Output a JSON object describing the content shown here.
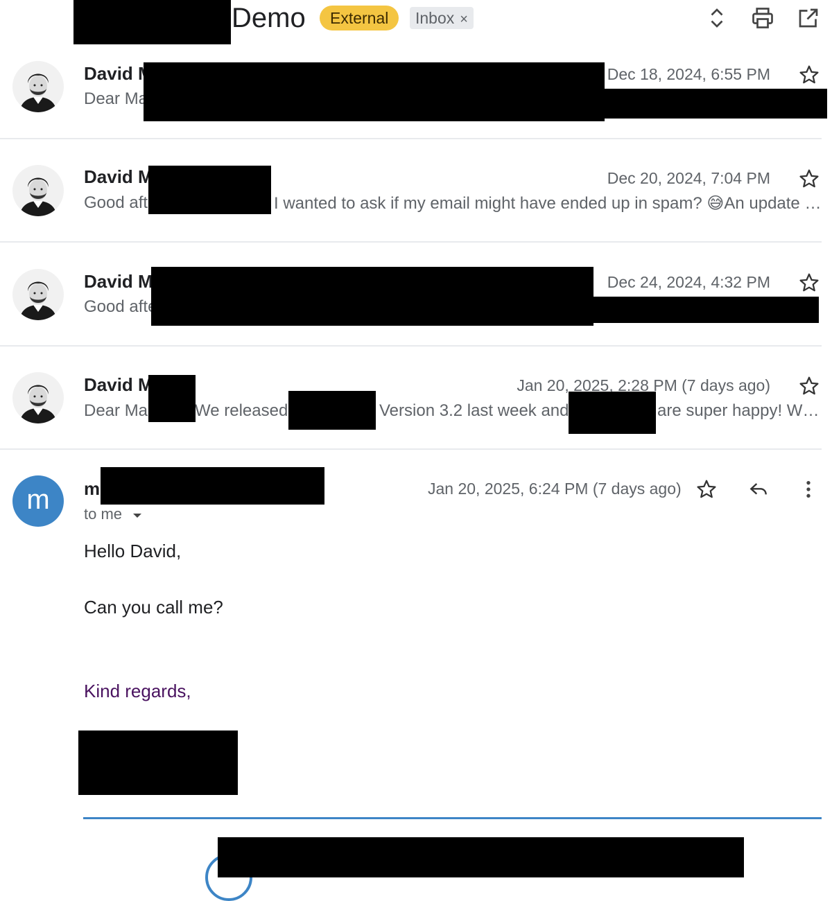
{
  "header": {
    "subject": "Demo",
    "labels": {
      "external": "External",
      "inbox": "Inbox",
      "inbox_remove": "×"
    },
    "icons": [
      "expand-collapse-icon",
      "print-icon",
      "open-in-new-window-icon"
    ]
  },
  "messages": [
    {
      "sender": "David M",
      "snippet": "Dear Ma",
      "date": "Dec 18, 2024, 6:55 PM",
      "snippet_tail": ""
    },
    {
      "sender": "David M",
      "snippet": "Good aft",
      "date": "Dec 20, 2024, 7:04 PM",
      "snippet_tail": "I wanted to ask if my email might have ended up in spam? 😅An update …"
    },
    {
      "sender": "David M",
      "snippet": "Good afte",
      "date": "Dec 24, 2024, 4:32 PM",
      "snippet_tail": ""
    },
    {
      "sender": "David M",
      "snippet": "Dear Ma",
      "date": "Jan 20, 2025, 2:28 PM (7 days ago)",
      "snippet_parts": [
        "We released",
        "Version 3.2 last week and",
        "are super happy! W…"
      ]
    }
  ],
  "open_message": {
    "avatar_letter": "m",
    "sender": "m",
    "recipient": "to me",
    "date": "Jan 20, 2025, 6:24 PM (7 days ago)",
    "body": {
      "greeting": "Hello David,",
      "line1": "Can you call me?",
      "closing": "Kind regards,"
    },
    "colors": {
      "avatar_bg": "#3d85c6",
      "closing": "#4a1360",
      "divider": "#3d85c6"
    }
  },
  "colors": {
    "external_label": "#f4c542",
    "inbox_label": "#e8eaed"
  }
}
